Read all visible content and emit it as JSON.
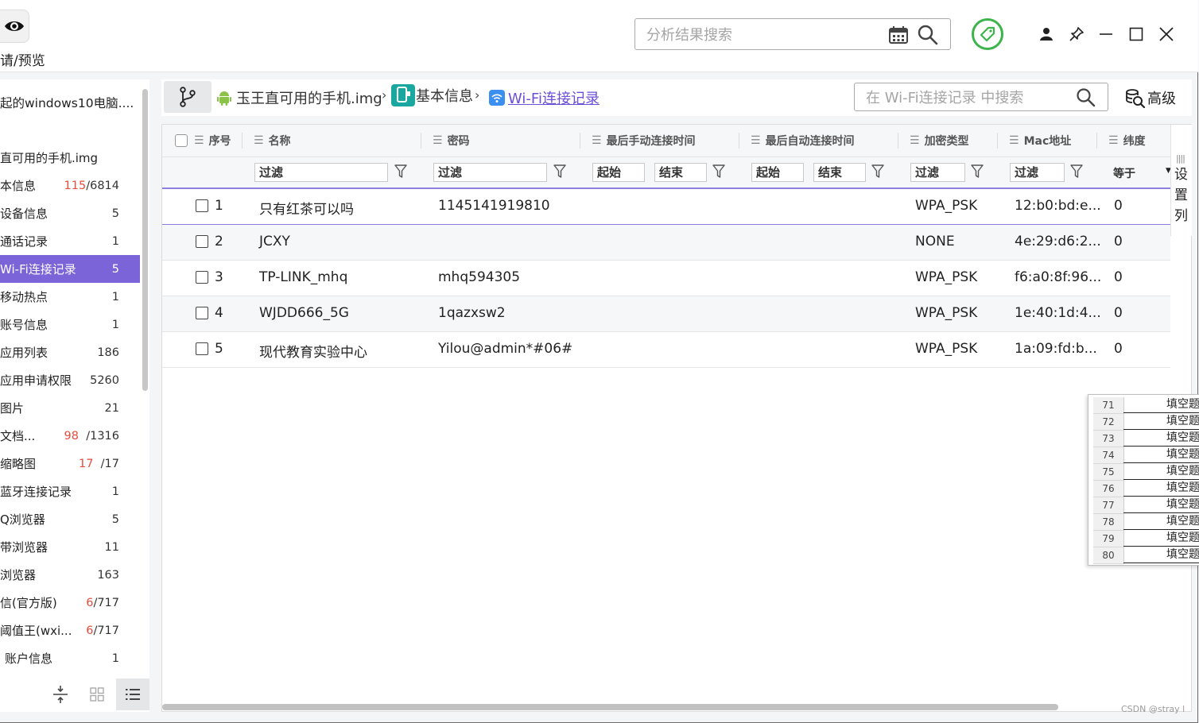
{
  "header": {
    "preview_label": "请/预览",
    "search_placeholder": "分析结果搜索"
  },
  "sidebar": {
    "title": "起的windows10电脑....",
    "items": [
      {
        "label": "直可用的手机.img",
        "count": "",
        "red": ""
      },
      {
        "label": "本信息",
        "count": "/6814",
        "red": "115"
      },
      {
        "label": "设备信息",
        "count": "5",
        "red": ""
      },
      {
        "label": "通话记录",
        "count": "1",
        "red": ""
      },
      {
        "label": "Wi-Fi连接记录",
        "count": "5",
        "red": ""
      },
      {
        "label": "移动热点",
        "count": "1",
        "red": ""
      },
      {
        "label": "账号信息",
        "count": "1",
        "red": ""
      },
      {
        "label": "应用列表",
        "count": "186",
        "red": ""
      },
      {
        "label": "应用申请权限",
        "count": "5260",
        "red": ""
      },
      {
        "label": "图片",
        "count": "21",
        "red": ""
      },
      {
        "label": "文档...",
        "count": "/1316",
        "red": "98"
      },
      {
        "label": "缩略图",
        "count": "/17",
        "red": "17"
      },
      {
        "label": "蓝牙连接记录",
        "count": "1",
        "red": ""
      },
      {
        "label": "Q浏览器",
        "count": "5",
        "red": ""
      },
      {
        "label": "带浏览器",
        "count": "11",
        "red": ""
      },
      {
        "label": "浏览器",
        "count": "163",
        "red": ""
      },
      {
        "label": "信(官方版)",
        "count": "/717",
        "red": "6"
      },
      {
        "label": "阈值王(wxi...",
        "count": "/717",
        "red": "6"
      },
      {
        "label": "账户信息",
        "count": "1",
        "red": ""
      }
    ]
  },
  "breadcrumb": {
    "item1": "玉王直可用的手机.img",
    "item2": "基本信息",
    "item3": "Wi-Fi连接记录",
    "sep": "›"
  },
  "table_search": {
    "placeholder": "在 Wi-Fi连接记录 中搜索",
    "advanced_label": "高级"
  },
  "table": {
    "headers": {
      "seq": "序号",
      "name": "名称",
      "password": "密码",
      "last_manual": "最后手动连接时间",
      "last_auto": "最后自动连接时间",
      "encryption": "加密类型",
      "mac": "Mac地址",
      "lat": "纬度"
    },
    "filters": {
      "filter": "过滤",
      "start": "起始",
      "end": "结束",
      "equals": "等于"
    },
    "settings_label": "设置列",
    "rows": [
      {
        "seq": "1",
        "name": "只有红茶可以吗",
        "password": "1145141919810",
        "enc": "WPA_PSK",
        "mac": "12:b0:bd:e...",
        "lat": "0"
      },
      {
        "seq": "2",
        "name": "JCXY",
        "password": "",
        "enc": "NONE",
        "mac": "4e:29:d6:2...",
        "lat": "0"
      },
      {
        "seq": "3",
        "name": "TP-LINK_mhq",
        "password": "mhq594305",
        "enc": "WPA_PSK",
        "mac": "f6:a0:8f:96...",
        "lat": "0"
      },
      {
        "seq": "4",
        "name": "WJDD666_5G",
        "password": "1qazxsw2",
        "enc": "WPA_PSK",
        "mac": "1e:40:1d:4...",
        "lat": "0"
      },
      {
        "seq": "5",
        "name": "现代教育实验中心",
        "password": "Yilou@admin*#06#",
        "enc": "WPA_PSK",
        "mac": "1a:09:fd:b...",
        "lat": "0"
      }
    ]
  },
  "sheet": {
    "rows": [
      {
        "n": "71",
        "v": "填空题"
      },
      {
        "n": "72",
        "v": "填空题"
      },
      {
        "n": "73",
        "v": "填空题"
      },
      {
        "n": "74",
        "v": "填空题"
      },
      {
        "n": "75",
        "v": "填空题"
      },
      {
        "n": "76",
        "v": "填空题"
      },
      {
        "n": "77",
        "v": "填空题"
      },
      {
        "n": "78",
        "v": "填空题"
      },
      {
        "n": "79",
        "v": "填空题"
      },
      {
        "n": "80",
        "v": "填空题"
      }
    ]
  },
  "watermark": "CSDN @stray l",
  "colors": {
    "accent": "#7b63d8",
    "link": "#6a4fd8",
    "green": "#3cb44b",
    "red_count": "#e74c3c"
  }
}
